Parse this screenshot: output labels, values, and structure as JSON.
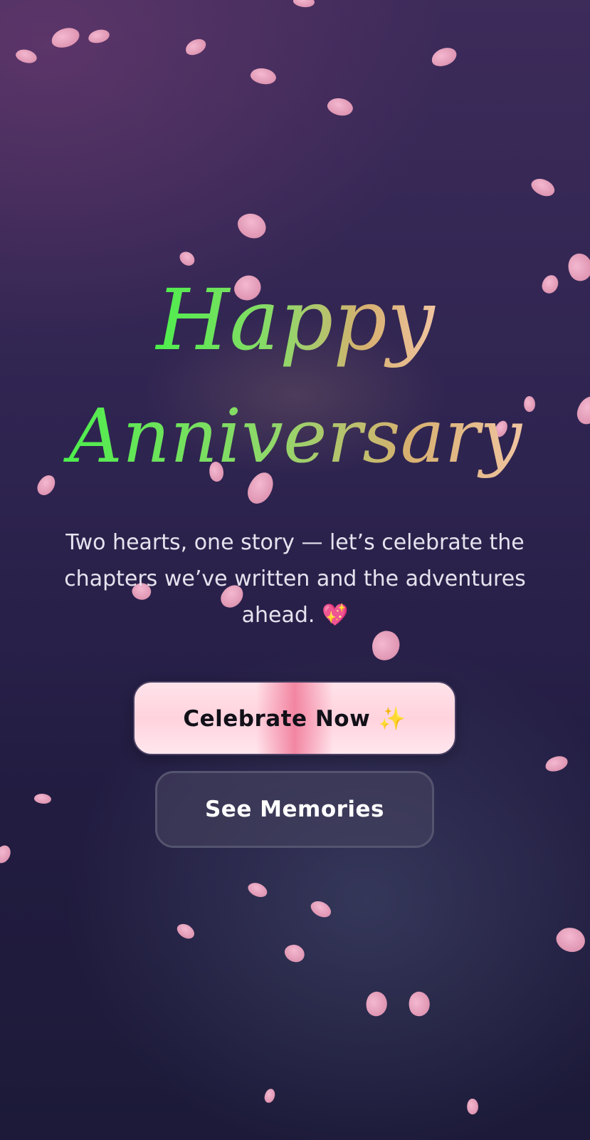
{
  "hero": {
    "title_line1": "Happy",
    "title_line2": "Anniversary",
    "subtitle": "Two hearts, one story — let’s celebrate the chapters we’ve written and the adventures ahead. 💖"
  },
  "actions": {
    "primary_label": "Celebrate Now ✨",
    "secondary_label": "See Memories"
  },
  "theme": {
    "background_top": "#3d2b5a",
    "background_bottom": "#1c1a38",
    "title_gradient_start": "#4dee4d",
    "title_gradient_end": "#f0c4a0",
    "petal_color": "#e29ab6",
    "primary_button_color": "#ffd3de",
    "secondary_button_color": "#484660"
  },
  "decor": {
    "petal_icon": "petal-icon",
    "heart_icon": "sparkling-heart-icon",
    "sparkles_icon": "sparkles-icon"
  }
}
